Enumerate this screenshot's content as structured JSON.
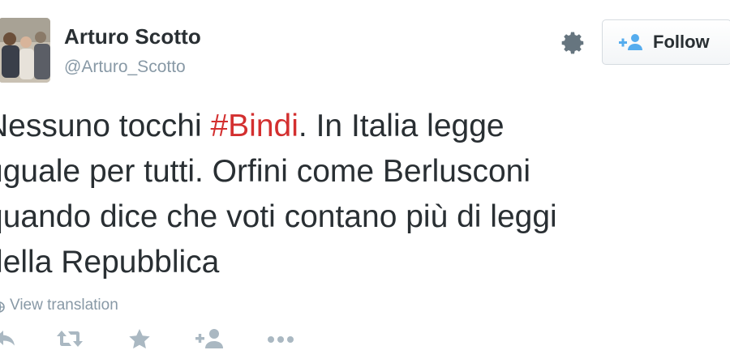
{
  "author": {
    "name": "Arturo Scotto",
    "handle": "@Arturo_Scotto"
  },
  "header": {
    "follow_label": "Follow"
  },
  "tweet": {
    "lines": [
      {
        "before": "Nessuno tocchi ",
        "hashtag": "#Bindi",
        "after": ". In Italia legge"
      },
      {
        "text": "uguale per tutti. Orfini come Berlusconi"
      },
      {
        "text": "quando dice che voti contano più di leggi"
      },
      {
        "text": "della Repubblica"
      }
    ]
  },
  "translation": {
    "label": "View translation"
  },
  "actions": [
    {
      "icon": "reply-icon"
    },
    {
      "icon": "retweet-icon"
    },
    {
      "icon": "favorite-star-icon"
    },
    {
      "icon": "follow-user-icon"
    },
    {
      "icon": "more-dots-icon"
    }
  ],
  "colors": {
    "hashtag": "#d32f2f",
    "secondary_text": "#8899a6",
    "primary_text": "#292f33",
    "icon_gray": "#aab8c2"
  }
}
